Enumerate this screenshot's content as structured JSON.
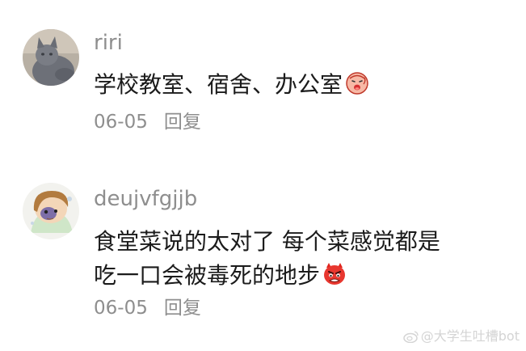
{
  "comments": [
    {
      "username": "riri",
      "lines": [
        "学校教室、宿舍、办公室"
      ],
      "emoji": "sad-face-emoji",
      "date": "06-05",
      "reply_label": "回复",
      "avatar_icon": "gray-cat-avatar"
    },
    {
      "username": "deujvfgjjb",
      "lines": [
        "食堂菜说的太对了 每个菜感觉都是",
        "吃一口会被毒死的地步"
      ],
      "emoji": "angry-devil-emoji",
      "date": "06-05",
      "reply_label": "回复",
      "avatar_icon": "cartoon-girl-avatar"
    }
  ],
  "watermark": {
    "text": "@大学生吐槽bot",
    "icon": "weibo-icon"
  },
  "colors": {
    "background": "#ffffff",
    "text_primary": "#1b1b1b",
    "text_secondary": "#8e8e8e",
    "watermark": "#d4d4d4"
  }
}
